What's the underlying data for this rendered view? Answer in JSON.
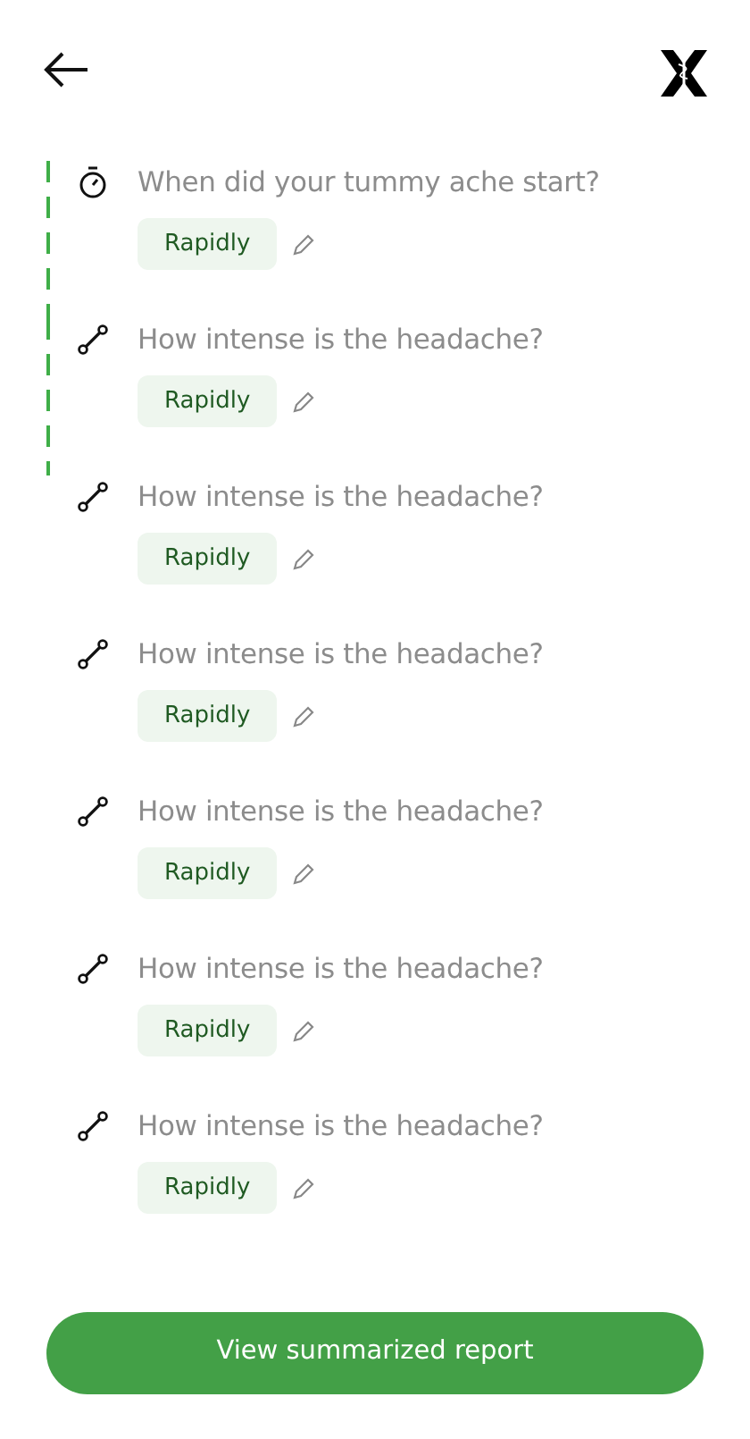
{
  "items": [
    {
      "kind": "timer",
      "question": "When did your tummy ache start?",
      "answer": "Rapidly",
      "line": true
    },
    {
      "kind": "path",
      "question": "How intense is the headache?",
      "answer": "Rapidly",
      "line": true
    },
    {
      "kind": "path",
      "question": "How intense is the headache?",
      "answer": "Rapidly",
      "line": false
    },
    {
      "kind": "path",
      "question": "How intense is the headache?",
      "answer": "Rapidly",
      "line": false
    },
    {
      "kind": "path",
      "question": "How intense is the headache?",
      "answer": "Rapidly",
      "line": false
    },
    {
      "kind": "path",
      "question": "How intense is the headache?",
      "answer": "Rapidly",
      "line": false
    },
    {
      "kind": "path",
      "question": "How intense is the headache?",
      "answer": "Rapidly",
      "line": false
    }
  ],
  "button": "View summarized report"
}
